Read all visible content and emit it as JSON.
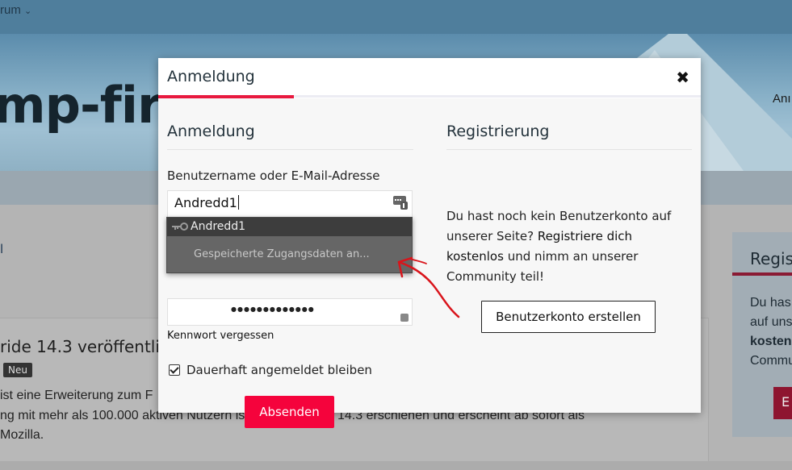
{
  "background": {
    "nav_item": "rum",
    "logo_text": "mp-fire",
    "header_link": "Anı",
    "article": {
      "title": "ride 14.3 veröffentlich",
      "badge": "Neu",
      "lines": [
        "ist eine Erweiterung zum F",
        "ng mit mehr als 100.000 aktiven Nutzern ist nun in Version 14.3 erschienen und erscheint ab sofort als",
        "Mozilla."
      ]
    },
    "sidebar": {
      "title": "Regist",
      "lines": [
        "Du has",
        "auf uns",
        "kosten",
        "Commu"
      ],
      "button": "E"
    },
    "left_mark": "l"
  },
  "modal": {
    "title": "Anmeldung",
    "close_icon": "close-icon",
    "login": {
      "heading": "Anmeldung",
      "username_label": "Benutzername oder E-Mail-Adresse",
      "username_value": "Andredd1",
      "password_mask": "●●●●●●●●●●●●●",
      "forgot_link": "Kennwort vergessen",
      "remember_label": "Dauerhaft angemeldet bleiben",
      "remember_checked": true,
      "submit_label": "Absenden"
    },
    "register": {
      "heading": "Registrierung",
      "text_before": "Du hast noch kein Benutzerkonto auf unserer Seite? ",
      "link_text": "Registriere dich kostenlos",
      "text_after": " und nimm an unserer Community teil!",
      "create_button": "Benutzerkonto erstellen"
    }
  },
  "autofill": {
    "username": "Andredd1",
    "saved_credentials": "Gespeicherte Zugangsdaten an..."
  },
  "colors": {
    "accent": "#f5033c",
    "accent_line": "#e8193f",
    "annotation": "#d9141b"
  }
}
